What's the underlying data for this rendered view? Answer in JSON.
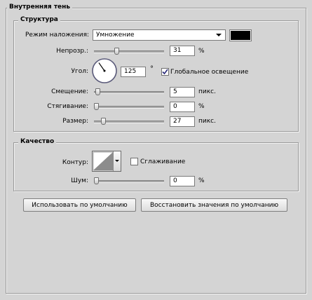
{
  "panel": {
    "title": "Внутренняя тень"
  },
  "structure": {
    "title": "Структура",
    "blend_mode": {
      "label": "Режим наложения:",
      "value": "Умножение",
      "color": "#000000"
    },
    "opacity": {
      "label": "Непрозр.:",
      "value": "31",
      "unit": "%",
      "level": 31
    },
    "angle": {
      "label": "Угол:",
      "value": "125",
      "unit": "°",
      "degrees": 125
    },
    "global_light": {
      "label": "Глобальное освещение",
      "checked": true
    },
    "distance": {
      "label": "Смещение:",
      "value": "5",
      "unit": "пикс.",
      "level": 2
    },
    "choke": {
      "label": "Стягивание:",
      "value": "0",
      "unit": "%",
      "level": 0
    },
    "size": {
      "label": "Размер:",
      "value": "27",
      "unit": "пикс.",
      "level": 11
    }
  },
  "quality": {
    "title": "Качество",
    "contour": {
      "label": "Контур:"
    },
    "antialias": {
      "label": "Сглаживание",
      "checked": false
    },
    "noise": {
      "label": "Шум:",
      "value": "0",
      "unit": "%",
      "level": 0
    }
  },
  "buttons": {
    "make_default": "Использовать по умолчанию",
    "reset_default": "Восстановить значения по умолчанию"
  }
}
